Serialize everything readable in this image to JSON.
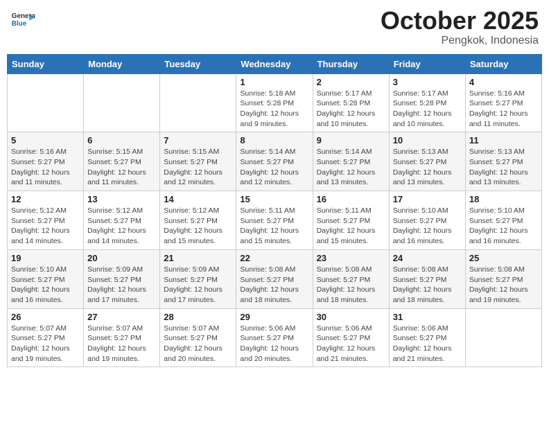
{
  "logo": {
    "general": "General",
    "blue": "Blue"
  },
  "title": "October 2025",
  "subtitle": "Pengkok, Indonesia",
  "weekdays": [
    "Sunday",
    "Monday",
    "Tuesday",
    "Wednesday",
    "Thursday",
    "Friday",
    "Saturday"
  ],
  "weeks": [
    [
      {
        "day": "",
        "info": ""
      },
      {
        "day": "",
        "info": ""
      },
      {
        "day": "",
        "info": ""
      },
      {
        "day": "1",
        "info": "Sunrise: 5:18 AM\nSunset: 5:28 PM\nDaylight: 12 hours\nand 9 minutes."
      },
      {
        "day": "2",
        "info": "Sunrise: 5:17 AM\nSunset: 5:28 PM\nDaylight: 12 hours\nand 10 minutes."
      },
      {
        "day": "3",
        "info": "Sunrise: 5:17 AM\nSunset: 5:28 PM\nDaylight: 12 hours\nand 10 minutes."
      },
      {
        "day": "4",
        "info": "Sunrise: 5:16 AM\nSunset: 5:27 PM\nDaylight: 12 hours\nand 11 minutes."
      }
    ],
    [
      {
        "day": "5",
        "info": "Sunrise: 5:16 AM\nSunset: 5:27 PM\nDaylight: 12 hours\nand 11 minutes."
      },
      {
        "day": "6",
        "info": "Sunrise: 5:15 AM\nSunset: 5:27 PM\nDaylight: 12 hours\nand 11 minutes."
      },
      {
        "day": "7",
        "info": "Sunrise: 5:15 AM\nSunset: 5:27 PM\nDaylight: 12 hours\nand 12 minutes."
      },
      {
        "day": "8",
        "info": "Sunrise: 5:14 AM\nSunset: 5:27 PM\nDaylight: 12 hours\nand 12 minutes."
      },
      {
        "day": "9",
        "info": "Sunrise: 5:14 AM\nSunset: 5:27 PM\nDaylight: 12 hours\nand 13 minutes."
      },
      {
        "day": "10",
        "info": "Sunrise: 5:13 AM\nSunset: 5:27 PM\nDaylight: 12 hours\nand 13 minutes."
      },
      {
        "day": "11",
        "info": "Sunrise: 5:13 AM\nSunset: 5:27 PM\nDaylight: 12 hours\nand 13 minutes."
      }
    ],
    [
      {
        "day": "12",
        "info": "Sunrise: 5:12 AM\nSunset: 5:27 PM\nDaylight: 12 hours\nand 14 minutes."
      },
      {
        "day": "13",
        "info": "Sunrise: 5:12 AM\nSunset: 5:27 PM\nDaylight: 12 hours\nand 14 minutes."
      },
      {
        "day": "14",
        "info": "Sunrise: 5:12 AM\nSunset: 5:27 PM\nDaylight: 12 hours\nand 15 minutes."
      },
      {
        "day": "15",
        "info": "Sunrise: 5:11 AM\nSunset: 5:27 PM\nDaylight: 12 hours\nand 15 minutes."
      },
      {
        "day": "16",
        "info": "Sunrise: 5:11 AM\nSunset: 5:27 PM\nDaylight: 12 hours\nand 15 minutes."
      },
      {
        "day": "17",
        "info": "Sunrise: 5:10 AM\nSunset: 5:27 PM\nDaylight: 12 hours\nand 16 minutes."
      },
      {
        "day": "18",
        "info": "Sunrise: 5:10 AM\nSunset: 5:27 PM\nDaylight: 12 hours\nand 16 minutes."
      }
    ],
    [
      {
        "day": "19",
        "info": "Sunrise: 5:10 AM\nSunset: 5:27 PM\nDaylight: 12 hours\nand 16 minutes."
      },
      {
        "day": "20",
        "info": "Sunrise: 5:09 AM\nSunset: 5:27 PM\nDaylight: 12 hours\nand 17 minutes."
      },
      {
        "day": "21",
        "info": "Sunrise: 5:09 AM\nSunset: 5:27 PM\nDaylight: 12 hours\nand 17 minutes."
      },
      {
        "day": "22",
        "info": "Sunrise: 5:08 AM\nSunset: 5:27 PM\nDaylight: 12 hours\nand 18 minutes."
      },
      {
        "day": "23",
        "info": "Sunrise: 5:08 AM\nSunset: 5:27 PM\nDaylight: 12 hours\nand 18 minutes."
      },
      {
        "day": "24",
        "info": "Sunrise: 5:08 AM\nSunset: 5:27 PM\nDaylight: 12 hours\nand 18 minutes."
      },
      {
        "day": "25",
        "info": "Sunrise: 5:08 AM\nSunset: 5:27 PM\nDaylight: 12 hours\nand 19 minutes."
      }
    ],
    [
      {
        "day": "26",
        "info": "Sunrise: 5:07 AM\nSunset: 5:27 PM\nDaylight: 12 hours\nand 19 minutes."
      },
      {
        "day": "27",
        "info": "Sunrise: 5:07 AM\nSunset: 5:27 PM\nDaylight: 12 hours\nand 19 minutes."
      },
      {
        "day": "28",
        "info": "Sunrise: 5:07 AM\nSunset: 5:27 PM\nDaylight: 12 hours\nand 20 minutes."
      },
      {
        "day": "29",
        "info": "Sunrise: 5:06 AM\nSunset: 5:27 PM\nDaylight: 12 hours\nand 20 minutes."
      },
      {
        "day": "30",
        "info": "Sunrise: 5:06 AM\nSunset: 5:27 PM\nDaylight: 12 hours\nand 21 minutes."
      },
      {
        "day": "31",
        "info": "Sunrise: 5:06 AM\nSunset: 5:27 PM\nDaylight: 12 hours\nand 21 minutes."
      },
      {
        "day": "",
        "info": ""
      }
    ]
  ]
}
